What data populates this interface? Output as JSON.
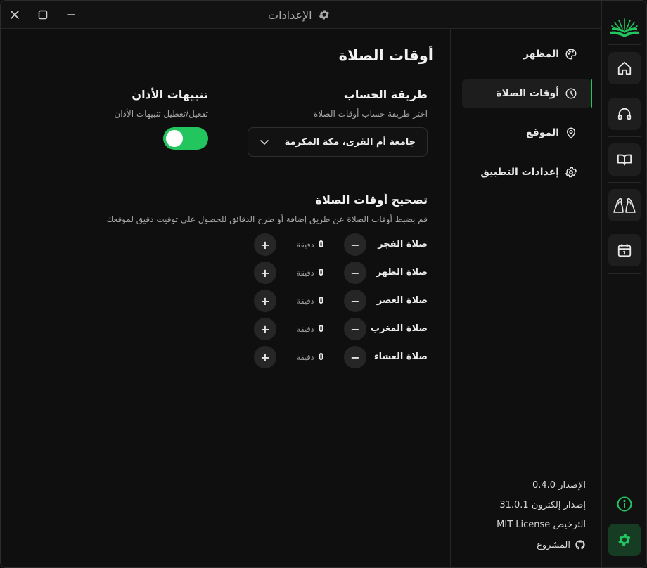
{
  "window": {
    "title": "الإعدادات",
    "title_icon": "gear-icon"
  },
  "rail": {
    "items": [
      {
        "name": "home",
        "icon": "home-icon"
      },
      {
        "name": "audio",
        "icon": "headphones-icon"
      },
      {
        "name": "quran",
        "icon": "book-icon"
      },
      {
        "name": "dua",
        "icon": "praying-hands-icon"
      },
      {
        "name": "calendar",
        "icon": "calendar-icon"
      }
    ],
    "info_icon": "info-icon",
    "settings_icon": "gear-icon",
    "accent": "#22c55e"
  },
  "sidebar": {
    "items": [
      {
        "label": "المظهر",
        "icon": "palette-icon"
      },
      {
        "label": "أوقات الصلاة",
        "icon": "clock-icon",
        "active": true
      },
      {
        "label": "الموقع",
        "icon": "location-pin-icon"
      },
      {
        "label": "إعدادات التطبيق",
        "icon": "gear-icon"
      }
    ],
    "about": {
      "version": "الإصدار 0.4.0",
      "electron": "إصدار إلكترون 31.0.1",
      "license": "الترخيص MIT License",
      "project": "المشروع",
      "project_icon": "github-icon"
    }
  },
  "main": {
    "title": "أوقات الصلاة",
    "calc": {
      "heading": "طريقة الحساب",
      "description": "اختر طريقة حساب أوقات الصلاة",
      "selected": "جامعة أم القرى، مكة المكرمة"
    },
    "adhan": {
      "heading": "تنبيهات الأذان",
      "description": "تفعيل/تعطيل تنبيهات الأذان",
      "enabled": true
    },
    "adjust": {
      "heading": "تصحيح أوقات الصلاة",
      "description": "قم بضبط أوقات الصلاة عن طريق إضافة أو طرح الدقائق للحصول على توقيت دقيق لموقعك",
      "unit": "دقيقة",
      "minus": "−",
      "plus": "+",
      "rows": [
        {
          "label": "صلاة الفجر",
          "value": "0"
        },
        {
          "label": "صلاة الظهر",
          "value": "0"
        },
        {
          "label": "صلاة العصر",
          "value": "0"
        },
        {
          "label": "صلاة المغرب",
          "value": "0"
        },
        {
          "label": "صلاة العشاء",
          "value": "0"
        }
      ]
    }
  }
}
